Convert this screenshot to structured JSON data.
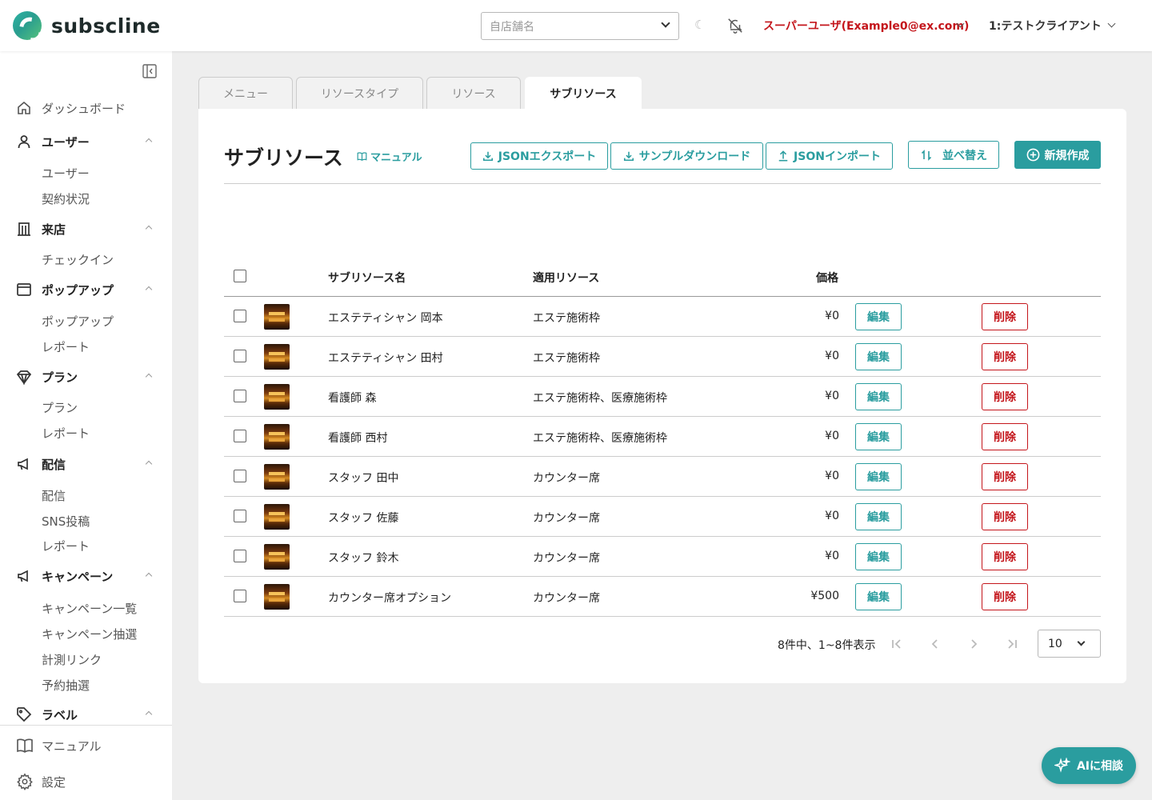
{
  "app": {
    "brand": "subscline",
    "brand_color": "#2a9d9f",
    "danger_color": "#c4161c"
  },
  "header": {
    "store_placeholder": "自店舗名",
    "user_label": "スーパーユーザ(Example0@ex.com)",
    "client_label": "1:テストクライアント",
    "icons": [
      "moon-icon",
      "bell-off-icon",
      "chevron-down-icon"
    ]
  },
  "sidebar": {
    "sections": [
      {
        "label": "ダッシュボード",
        "icon": "home-icon",
        "items": []
      },
      {
        "label": "ユーザー",
        "icon": "person-icon",
        "items": [
          "ユーザー",
          "契約状況"
        ]
      },
      {
        "label": "来店",
        "icon": "building-icon",
        "items": [
          "チェックイン"
        ]
      },
      {
        "label": "ポップアップ",
        "icon": "window-icon",
        "items": [
          "ポップアップ",
          "レポート"
        ]
      },
      {
        "label": "プラン",
        "icon": "diamond-icon",
        "items": [
          "プラン",
          "レポート"
        ]
      },
      {
        "label": "配信",
        "icon": "megaphone-icon",
        "items": [
          "配信",
          "SNS投稿",
          "レポート"
        ]
      },
      {
        "label": "キャンペーン",
        "icon": "megaphone-icon",
        "items": [
          "キャンペーン一覧",
          "キャンペーン抽選",
          "計測リンク",
          "予約抽選"
        ]
      },
      {
        "label": "ラベル",
        "icon": "tag-icon",
        "items": []
      }
    ],
    "footer": [
      {
        "label": "マニュアル",
        "icon": "book-icon"
      },
      {
        "label": "設定",
        "icon": "gear-icon"
      }
    ]
  },
  "tabs": [
    {
      "label": "メニュー",
      "active": false
    },
    {
      "label": "リソースタイプ",
      "active": false
    },
    {
      "label": "リソース",
      "active": false
    },
    {
      "label": "サブリソース",
      "active": true
    }
  ],
  "page": {
    "title": "サブリソース",
    "manual_label": "マニュアル",
    "export_label": "JSONエクスポート",
    "sample_label": "サンプルダウンロード",
    "import_label": "JSONインポート",
    "sort_label": "並べ替え",
    "new_label": "新規作成"
  },
  "table": {
    "headers": {
      "name": "サブリソース名",
      "resource": "適用リソース",
      "price": "価格"
    },
    "edit_label": "編集",
    "delete_label": "削除",
    "rows": [
      {
        "name": "エステティシャン 岡本",
        "resource": "エステ施術枠",
        "price": "¥0"
      },
      {
        "name": "エステティシャン 田村",
        "resource": "エステ施術枠",
        "price": "¥0"
      },
      {
        "name": "看護師 森",
        "resource": "エステ施術枠、医療施術枠",
        "price": "¥0"
      },
      {
        "name": "看護師 西村",
        "resource": "エステ施術枠、医療施術枠",
        "price": "¥0"
      },
      {
        "name": "スタッフ 田中",
        "resource": "カウンター席",
        "price": "¥0"
      },
      {
        "name": "スタッフ 佐藤",
        "resource": "カウンター席",
        "price": "¥0"
      },
      {
        "name": "スタッフ 鈴木",
        "resource": "カウンター席",
        "price": "¥0"
      },
      {
        "name": "カウンター席オプション",
        "resource": "カウンター席",
        "price": "¥500"
      }
    ]
  },
  "pagination": {
    "info": "8件中、1~8件表示",
    "per_page": "10"
  },
  "ai_button": {
    "label": "AIに相談"
  }
}
